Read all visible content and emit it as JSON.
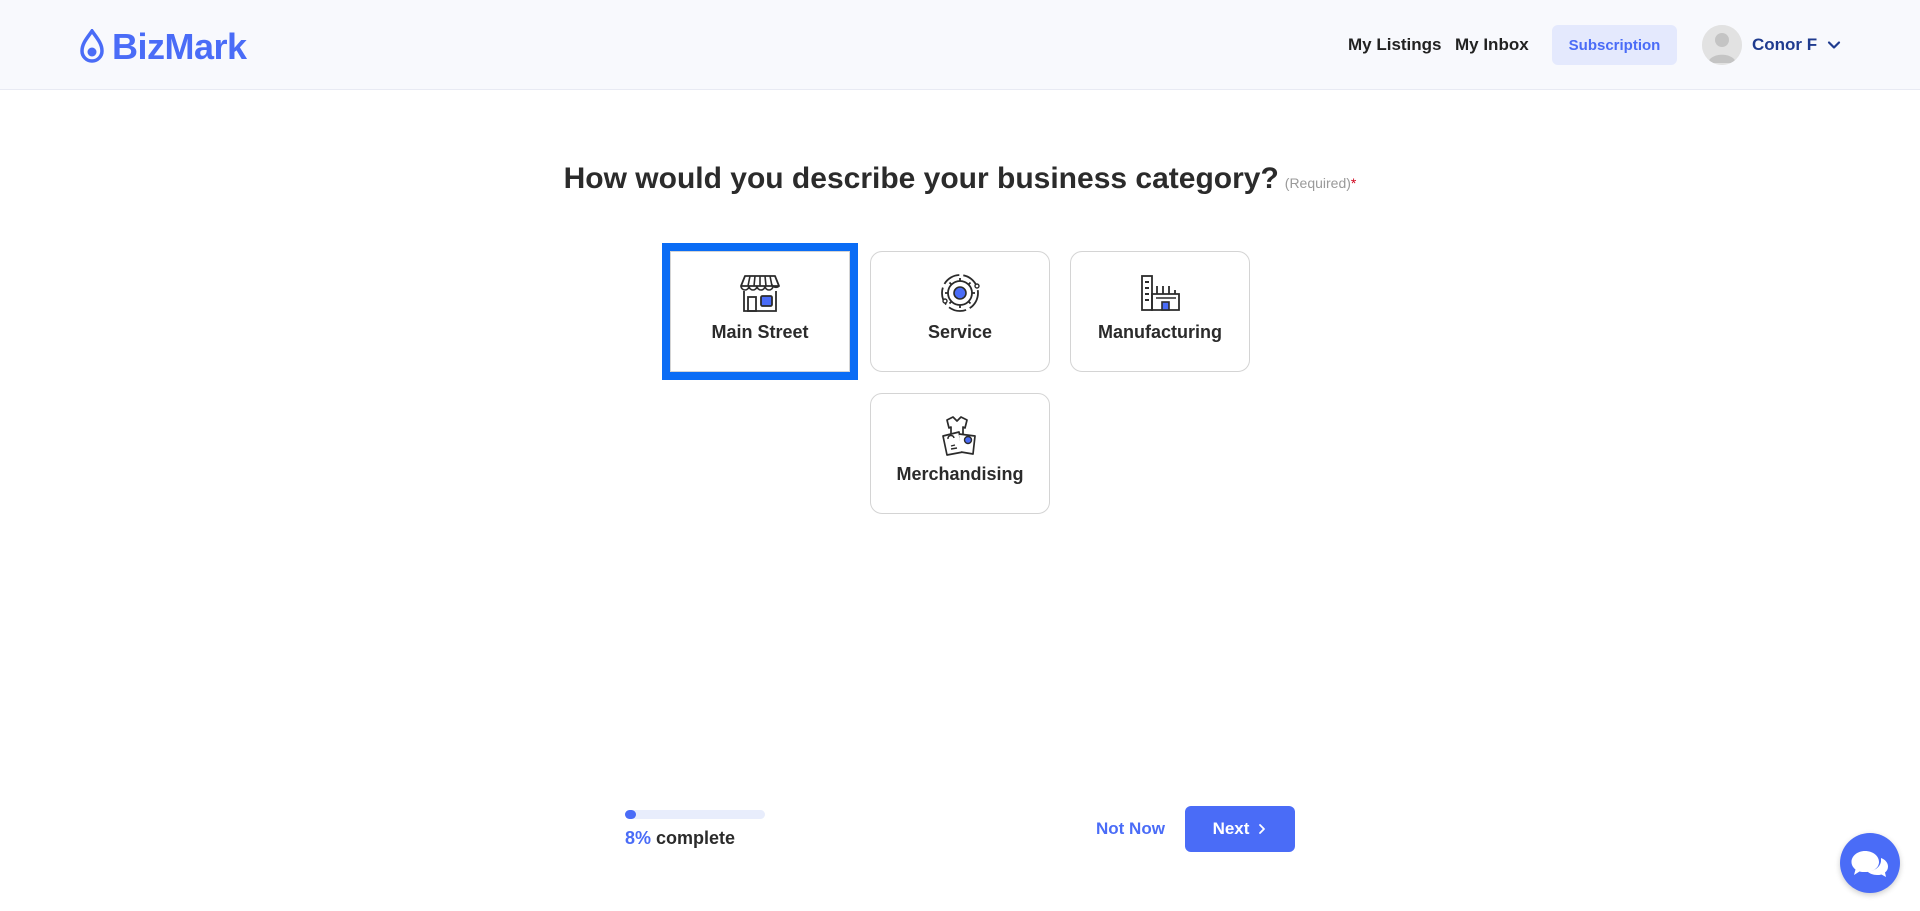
{
  "header": {
    "logo_text": "BizMark",
    "nav": {
      "my_listings": "My Listings",
      "my_inbox": "My Inbox",
      "subscription": "Subscription"
    },
    "user": {
      "name": "Conor F"
    }
  },
  "question": {
    "title": "How would you describe your business category?",
    "required_label": "(Required)",
    "required_star": "*"
  },
  "options": [
    {
      "label": "Main Street",
      "icon": "storefront-icon",
      "selected": true
    },
    {
      "label": "Service",
      "icon": "gear-service-icon",
      "selected": false
    },
    {
      "label": "Manufacturing",
      "icon": "factory-icon",
      "selected": false
    },
    {
      "label": "Merchandising",
      "icon": "shopping-bag-icon",
      "selected": false
    }
  ],
  "progress": {
    "percent": 8,
    "percent_label": "8%",
    "suffix": "complete"
  },
  "actions": {
    "not_now": "Not Now",
    "next": "Next"
  },
  "colors": {
    "accent": "#4a6cf7",
    "selection_outline": "#0a6cf5",
    "header_bg": "#f8f9fd",
    "required_star": "#d0021b"
  }
}
